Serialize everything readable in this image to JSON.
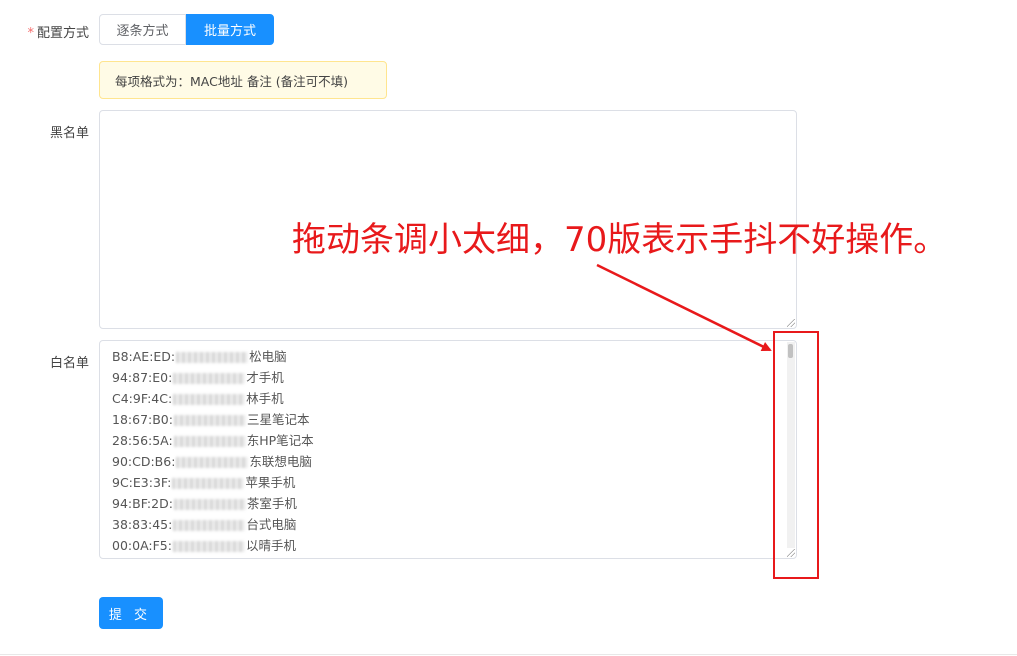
{
  "form": {
    "mode_label": "配置方式",
    "required_mark": "*",
    "mode_options": [
      "逐条方式",
      "批量方式"
    ],
    "mode_selected": "批量方式",
    "hint": "每项格式为：MAC地址 备注 (备注可不填)",
    "blacklist_label": "黑名单",
    "blacklist_value": "",
    "whitelist_label": "白名单",
    "whitelist_lines": [
      {
        "prefix": "B8:AE:ED:",
        "suffix": "松电脑"
      },
      {
        "prefix": "94:87:E0:",
        "suffix": "才手机"
      },
      {
        "prefix": "C4:9F:4C:",
        "suffix": "林手机"
      },
      {
        "prefix": "18:67:B0:",
        "suffix": "三星笔记本"
      },
      {
        "prefix": "28:56:5A:",
        "suffix": "东HP笔记本"
      },
      {
        "prefix": "90:CD:B6:",
        "suffix": "东联想电脑"
      },
      {
        "prefix": "9C:E3:3F:",
        "suffix": "苹果手机"
      },
      {
        "prefix": "94:BF:2D:",
        "suffix": "茶室手机"
      },
      {
        "prefix": "38:83:45:",
        "suffix": "台式电脑"
      },
      {
        "prefix": "00:0A:F5:",
        "suffix": "以晴手机"
      }
    ],
    "submit_label": "提 交"
  },
  "annotation": {
    "text": "拖动条调小太细，70版表示手抖不好操作。",
    "color": "#e8191b"
  },
  "colors": {
    "primary": "#1890ff",
    "hint_bg": "#fffbe6",
    "hint_border": "#ffe58f",
    "required": "#f56c6c"
  }
}
